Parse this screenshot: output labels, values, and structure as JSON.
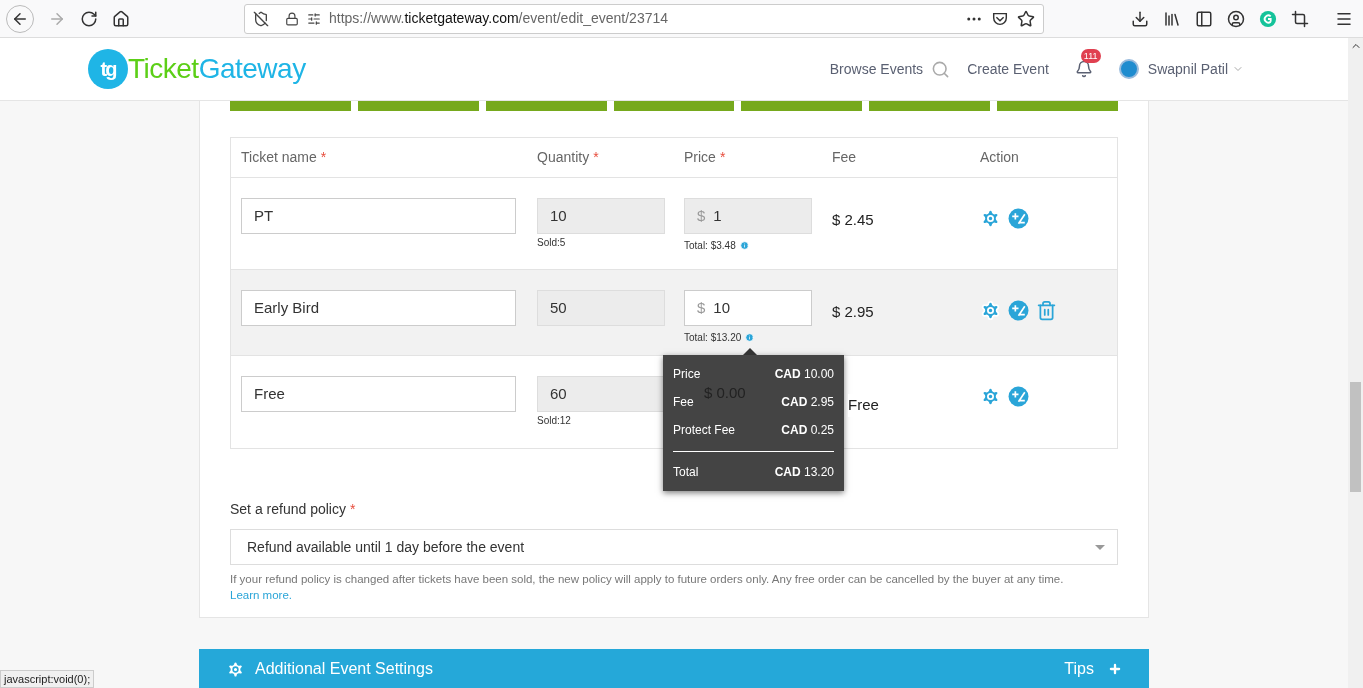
{
  "browser": {
    "url": {
      "scheme": "https://www.",
      "host": "ticketgateway.com",
      "path": "/event/edit_event/23714"
    }
  },
  "header": {
    "logo": {
      "mark": "tg",
      "word_1": "Ticket",
      "word_2": "Gateway"
    },
    "nav": [
      "Browse Events",
      "Create Event"
    ],
    "notifications": "111",
    "user": "Swapnil Patil"
  },
  "tickets": {
    "columns": [
      {
        "label": "Ticket name",
        "required_mark": "*"
      },
      {
        "label": "Quantity",
        "required_mark": "*"
      },
      {
        "label": "Price",
        "required_mark": "*"
      },
      {
        "label": "Fee"
      },
      {
        "label": "Action"
      }
    ],
    "rows": [
      {
        "name": "PT",
        "quantity": "10",
        "sold": "Sold:5",
        "currency": "$",
        "price": "1",
        "price_disabled": true,
        "total": "Total: $3.48",
        "fee": "$ 2.45",
        "highlighted": false,
        "deletable": false
      },
      {
        "name": "Early Bird",
        "quantity": "50",
        "currency": "$",
        "price": "10",
        "price_disabled": false,
        "total": "Total: $13.20",
        "fee": "$ 2.95",
        "highlighted": true,
        "deletable": true
      },
      {
        "name": "Free",
        "quantity": "60",
        "sold": "Sold:12",
        "price": "$ 0.00",
        "fee": "Free",
        "highlighted": false,
        "deletable": false
      }
    ]
  },
  "tooltip": {
    "lines": [
      {
        "label": "Price",
        "currency": "CAD",
        "amount": "10.00"
      },
      {
        "label": "Fee",
        "currency": "CAD",
        "amount": "2.95"
      },
      {
        "label": "Protect Fee",
        "currency": "CAD",
        "amount": "0.25"
      }
    ],
    "total": {
      "label": "Total",
      "currency": "CAD",
      "amount": "13.20"
    }
  },
  "refund": {
    "label": "Set a refund policy",
    "required_mark": "*",
    "value": "Refund available until 1 day before the event",
    "help": "If your refund policy is changed after tickets have been sold, the new policy will apply to future orders only. Any free order can be cancelled by the buyer at any time.",
    "link": "Learn more."
  },
  "settings_bar": {
    "title": "Additional Event Settings",
    "tips": "Tips"
  },
  "status_bar": "javascript:void(0);"
}
